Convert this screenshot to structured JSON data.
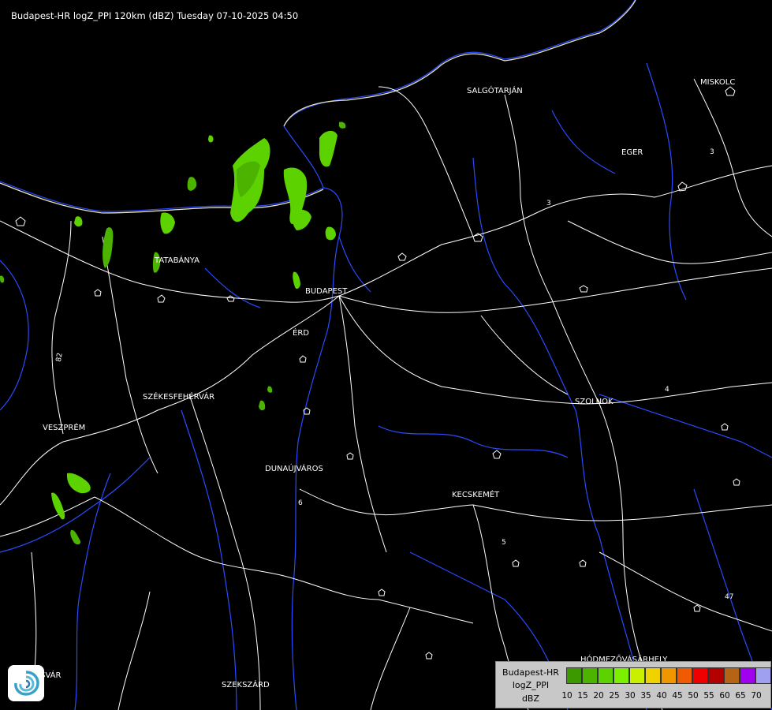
{
  "title": "Budapest-HR logZ_PPI 120km (dBZ) Tuesday 07-10-2025 04:50",
  "cities": [
    {
      "name": "SALGÓTARJÁN",
      "key": "salgotarjan"
    },
    {
      "name": "EGER",
      "key": "eger"
    },
    {
      "name": "MISKOLC",
      "key": "miskolc"
    },
    {
      "name": "TATABÁNYA",
      "key": "tatabanya"
    },
    {
      "name": "BUDAPEST",
      "key": "budapest"
    },
    {
      "name": "ÉRD",
      "key": "erd"
    },
    {
      "name": "SZÉKESFEHÉRVÁR",
      "key": "szekesfehervar"
    },
    {
      "name": "SZOLNOK",
      "key": "szolnok"
    },
    {
      "name": "VESZPRÉM",
      "key": "veszprem"
    },
    {
      "name": "DUNAÚJVÁROS",
      "key": "dunaujvaros"
    },
    {
      "name": "KECSKEMÉT",
      "key": "kecskemet"
    },
    {
      "name": "HÓDMEZŐVÁSÁRHELY",
      "key": "hodmezovasarhely"
    },
    {
      "name": "SZEKSZÁRD",
      "key": "szekszard"
    },
    {
      "name": "KAPOSVÁR",
      "key": "kaposvar"
    }
  ],
  "road_numbers": [
    "82",
    "3",
    "3",
    "4",
    "47",
    "6",
    "5"
  ],
  "legend": {
    "line1": "Budapest-HR",
    "line2": "logZ_PPI",
    "line3": "dBZ",
    "scale": [
      {
        "value": "10",
        "color": "#3c9a00"
      },
      {
        "value": "15",
        "color": "#4cb400"
      },
      {
        "value": "20",
        "color": "#5cd200"
      },
      {
        "value": "25",
        "color": "#7cf000"
      },
      {
        "value": "30",
        "color": "#c8f000"
      },
      {
        "value": "35",
        "color": "#f0d200"
      },
      {
        "value": "40",
        "color": "#f09600"
      },
      {
        "value": "45",
        "color": "#f05a00"
      },
      {
        "value": "50",
        "color": "#f00000"
      },
      {
        "value": "55",
        "color": "#b40000"
      },
      {
        "value": "60",
        "color": "#b46414"
      },
      {
        "value": "65",
        "color": "#a000f0"
      },
      {
        "value": "70",
        "color": "#a0a0f0"
      }
    ]
  },
  "colors": {
    "background": "#000000",
    "roads": "#ffffff",
    "rivers": "#2a4bff",
    "echo_light": "#5cd200",
    "echo_dark": "#3c9a00"
  },
  "logo_icon": "met-service-swirl-icon"
}
